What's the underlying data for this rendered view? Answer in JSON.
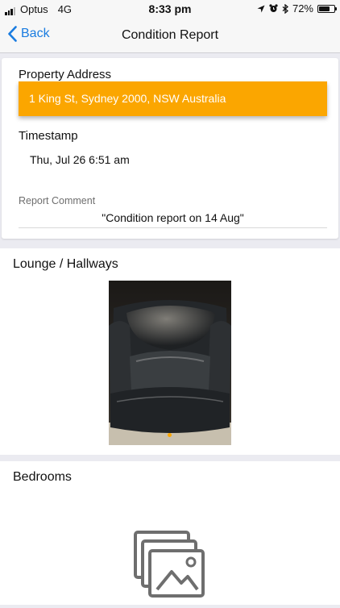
{
  "status_bar": {
    "carrier": "Optus",
    "network": "4G",
    "time": "8:33 pm",
    "battery_text": "72%",
    "battery_level": 0.72,
    "signal_bars_active": 3,
    "icons": [
      "signal-icon",
      "location-icon",
      "alarm-icon",
      "bluetooth-icon",
      "battery-icon"
    ]
  },
  "nav": {
    "back_label": "Back",
    "title": "Condition Report"
  },
  "report": {
    "address_label": "Property Address",
    "address_value": "1 King St, Sydney 2000, NSW Australia",
    "timestamp_label": "Timestamp",
    "timestamp_value": "Thu, Jul 26 6:51 am",
    "comment_label": "Report Comment",
    "comment_value": "\"Condition report on 14 Aug\""
  },
  "sections": [
    {
      "title": "Lounge / Hallways",
      "photo": "leather-armchair-photo",
      "page_indicator_count": 1
    },
    {
      "title": "Bedrooms",
      "photo": "image-placeholder-icon"
    }
  ],
  "colors": {
    "accent": "#fba600",
    "link": "#1a7ce0",
    "background": "#ebebf1"
  }
}
